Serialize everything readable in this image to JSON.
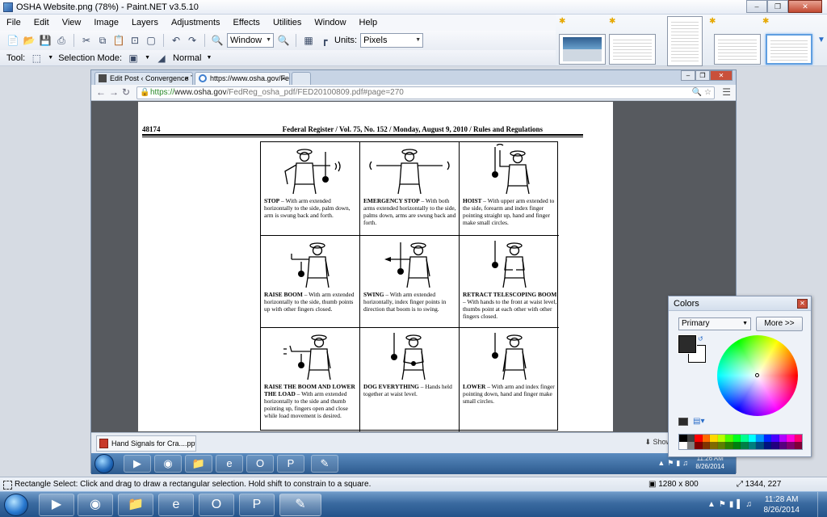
{
  "app": {
    "title": "OSHA Website.png (78%) - Paint.NET v3.5.10",
    "menu": [
      "File",
      "Edit",
      "View",
      "Image",
      "Layers",
      "Adjustments",
      "Effects",
      "Utilities",
      "Window",
      "Help"
    ],
    "zoom_value": "Window",
    "units_label": "Units:",
    "units_value": "Pixels",
    "tool_label": "Tool:",
    "selection_mode_label": "Selection Mode:",
    "selection_mode_value": "Normal"
  },
  "browser": {
    "tabs": [
      {
        "label": "Edit Post ‹ Convergence T"
      },
      {
        "label": "https://www.osha.gov/Fe"
      }
    ],
    "url_https": "https://",
    "url_host": "www.osha.gov",
    "url_rest": "/FedReg_osha_pdf/FED20100809.pdf#page=270",
    "download_item": "Hand Signals for Cra....ppt",
    "show_all": "Show"
  },
  "pdf": {
    "page_number": "48174",
    "header": "Federal Register / Vol. 75, No. 152 / Monday, August 9, 2010 / Rules and Regulations",
    "signals": [
      {
        "title": "STOP",
        "desc": "With arm extended horizontally to the side, palm down, arm is swung back and forth."
      },
      {
        "title": "EMERGENCY STOP",
        "desc": "With both arms extended horizontally to the side, palms down, arms are swung back and forth."
      },
      {
        "title": "HOIST",
        "desc": "With upper arm extended to the side, forearm and index finger pointing straight up, hand and finger make small circles."
      },
      {
        "title": "RAISE BOOM",
        "desc": "With arm extended horizontally to the side, thumb points up with other fingers closed."
      },
      {
        "title": "SWING",
        "desc": "With arm extended horizontally, index finger points in direction that boom is to swing."
      },
      {
        "title": "RETRACT TELESCOPING BOOM",
        "desc": "With hands to the front at waist level, thumbs point at each other with other fingers closed."
      },
      {
        "title": "RAISE THE BOOM AND LOWER THE LOAD",
        "desc": "With arm extended horizontally to the side and thumb pointing up, fingers open and close while load movement is desired."
      },
      {
        "title": "DOG EVERYTHING",
        "desc": "Hands held together at waist level."
      },
      {
        "title": "LOWER",
        "desc": "With arm and index finger pointing down, hand and finger make small circles."
      }
    ]
  },
  "inner_clock": {
    "time": "11:26 AM",
    "date": "8/26/2014"
  },
  "colors_window": {
    "title": "Colors",
    "mode": "Primary",
    "more_button": "More >>",
    "primary_color": "#2b2b2b",
    "secondary_color": "#ffffff"
  },
  "status": {
    "hint": "Rectangle Select: Click and drag to draw a rectangular selection. Hold shift to constrain to a square.",
    "image_size": "1280 x 800",
    "cursor_pos": "1344, 227"
  },
  "taskbar": {
    "time": "11:28 AM",
    "date": "8/26/2014"
  }
}
